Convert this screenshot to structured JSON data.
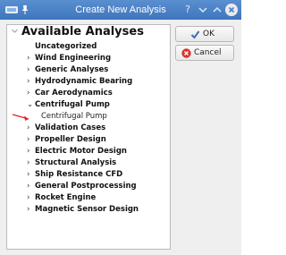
{
  "window": {
    "title": "Create New Analysis",
    "help_label": "?"
  },
  "tree": {
    "root_label": "Available Analyses",
    "items": [
      {
        "label": "Uncategorized",
        "expandable": false
      },
      {
        "label": "Wind Engineering",
        "expandable": true,
        "expanded": false
      },
      {
        "label": "Generic Analyses",
        "expandable": true,
        "expanded": false
      },
      {
        "label": "Hydrodynamic Bearing",
        "expandable": true,
        "expanded": false
      },
      {
        "label": "Car Aerodynamics",
        "expandable": true,
        "expanded": false
      },
      {
        "label": "Centrifugal Pump",
        "expandable": true,
        "expanded": true
      },
      {
        "label": "Validation Cases",
        "expandable": true,
        "expanded": false
      },
      {
        "label": "Propeller Design",
        "expandable": true,
        "expanded": false
      },
      {
        "label": "Electric Motor Design",
        "expandable": true,
        "expanded": false
      },
      {
        "label": "Structural Analysis",
        "expandable": true,
        "expanded": false
      },
      {
        "label": "Ship Resistance CFD",
        "expandable": true,
        "expanded": false
      },
      {
        "label": "General Postprocessing",
        "expandable": true,
        "expanded": false
      },
      {
        "label": "Rocket Engine",
        "expandable": true,
        "expanded": false
      },
      {
        "label": "Magnetic Sensor Design",
        "expandable": true,
        "expanded": false
      }
    ],
    "child": {
      "label": "Centrifugal Pump"
    },
    "collapsed_glyph": "›",
    "expanded_glyph": "⌄"
  },
  "buttons": {
    "ok_label": "OK",
    "cancel_label": "Cancel"
  },
  "colors": {
    "titlebar": "#4a80c6",
    "arrow": "#e32222",
    "ok_icon": "#3b6fb3",
    "cancel_icon": "#d7352b"
  },
  "icons": {
    "app": "app-icon",
    "pin": "pin-icon",
    "ok": "checkmark-icon",
    "cancel": "cancel-icon",
    "close": "close-icon",
    "minimize": "minimize-icon",
    "maximize": "maximize-icon"
  }
}
